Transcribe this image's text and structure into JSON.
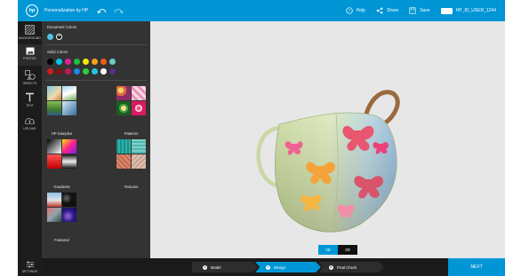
{
  "header": {
    "logo_text": "hp",
    "title": "Personalization by HP",
    "help_label": "Help",
    "share_label": "Share",
    "save_label": "Save",
    "user_label": "HP_ID_USER_1244"
  },
  "rail": {
    "items": [
      {
        "label": "BACKGROUND",
        "icon": "background-pattern-icon"
      },
      {
        "label": "PHOTOS",
        "icon": "image-icon"
      },
      {
        "label": "OBJECTS",
        "icon": "objects-icon"
      },
      {
        "label": "TEXT",
        "icon": "text-t-icon"
      },
      {
        "label": "UPLOAD",
        "icon": "cloud-upload-icon"
      }
    ],
    "settings_label": "SETTINGS"
  },
  "panel": {
    "document_colors_title": "Document Colors",
    "document_colors": [
      "#4fc3e8",
      "#ffffff"
    ],
    "solid_colors_title": "Solid Colors",
    "solid_colors_row1": [
      "#000000",
      "#00c8e6",
      "#e0219a",
      "#1fbf3a",
      "#f4e600",
      "#f7a21b",
      "#f25c14",
      "#6bcbc1"
    ],
    "solid_colors_row2": [
      "#d41c1c",
      "#8b1010",
      "#c2185b",
      "#1e88e5",
      "#2ecc40",
      "#26c6da",
      "#ffffff",
      "#5b2d8e"
    ],
    "categories": [
      {
        "label": "HP Samples"
      },
      {
        "label": "Patterns"
      },
      {
        "label": "Gradients"
      },
      {
        "label": "Textures"
      },
      {
        "label": "Featured"
      }
    ]
  },
  "canvas": {
    "view_3d_label": "3D",
    "view_2d_label": "2D",
    "background": "#e7e7e7"
  },
  "footer": {
    "steps": [
      {
        "num": "1",
        "label": "Model"
      },
      {
        "num": "2",
        "label": "Design"
      },
      {
        "num": "3",
        "label": "Final Check"
      }
    ],
    "active_step": 2,
    "next_label": "NEXT"
  },
  "colors": {
    "brand_blue": "#0096d6",
    "panel_bg": "#333333",
    "rail_bg": "#1c1c1c"
  }
}
